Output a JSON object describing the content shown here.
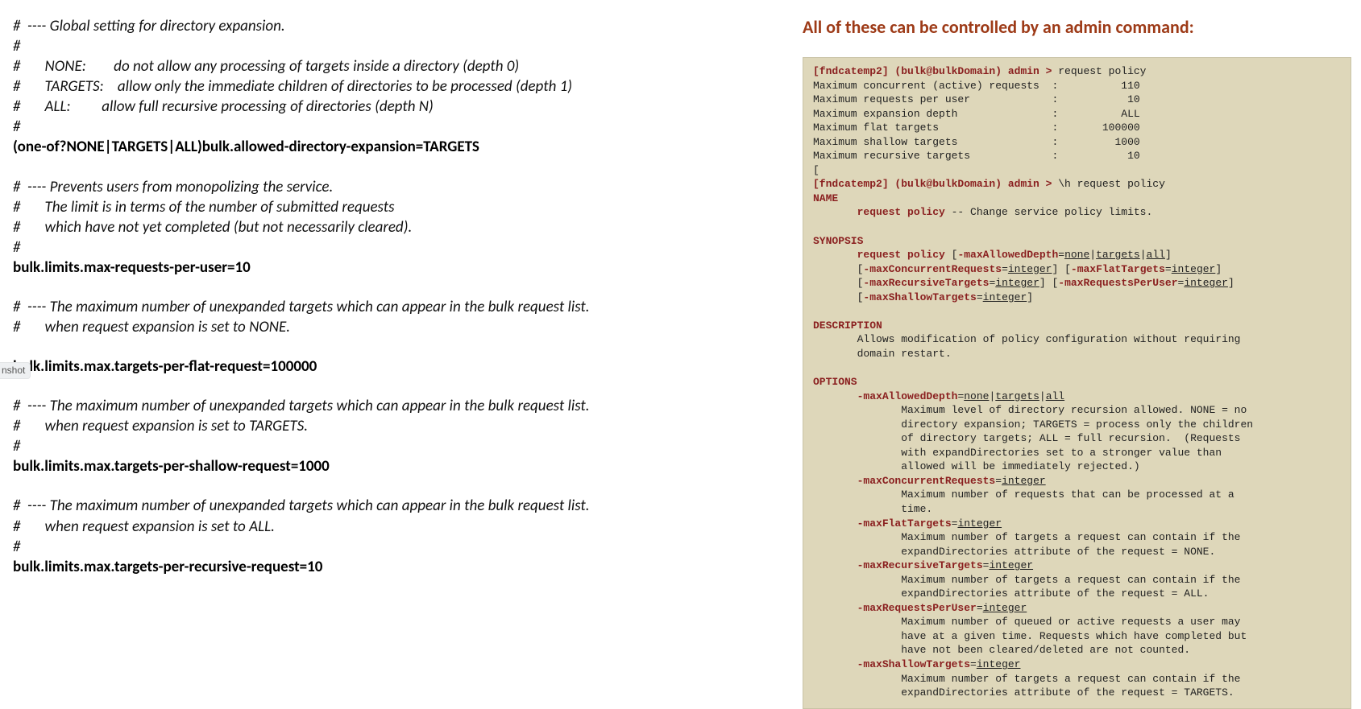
{
  "left": {
    "block1": {
      "c1": "#  ---- Global setting for directory expansion.",
      "c2": "#",
      "c3": "#       NONE:        do not allow any processing of targets inside a directory (depth 0)",
      "c4": "#       TARGETS:    allow only the immediate children of directories to be processed (depth 1)",
      "c5": "#       ALL:         allow full recursive processing of directories (depth N)",
      "c6": "#",
      "s": "(one-of?NONE|TARGETS|ALL)bulk.allowed-directory-expansion=TARGETS"
    },
    "block2": {
      "c1": "#  ---- Prevents users from monopolizing the service.",
      "c2": "#       The limit is in terms of the number of submitted requests",
      "c3": "#       which have not yet completed (but not necessarily cleared).",
      "c4": "#",
      "s": "bulk.limits.max-requests-per-user=10"
    },
    "block3": {
      "c1": "#  ---- The maximum number of unexpanded targets which can appear in the bulk request list.",
      "c2": "#       when request expansion is set to NONE.",
      "s": "bulk.limits.max.targets-per-flat-request=100000"
    },
    "block4": {
      "c1": "#  ---- The maximum number of unexpanded targets which can appear in the bulk request list.",
      "c2": "#       when request expansion is set to TARGETS.",
      "c3": "#",
      "s": "bulk.limits.max.targets-per-shallow-request=1000"
    },
    "block5": {
      "c1": "#  ---- The maximum number of unexpanded targets which can appear in the bulk request list.",
      "c2": "#       when request expansion is set to ALL.",
      "c3": "#",
      "s": "bulk.limits.max.targets-per-recursive-request=10"
    }
  },
  "right": {
    "heading": "All of these can be controlled by an admin command:",
    "term": {
      "p1_prompt": "[fndcatemp2] (bulk@bulkDomain) admin > ",
      "p1_cmd": "request policy",
      "rows": {
        "r1": {
          "label": "Maximum concurrent (active) requests",
          "value": "110"
        },
        "r2": {
          "label": "Maximum requests per user",
          "value": "10"
        },
        "r3": {
          "label": "Maximum expansion depth",
          "value": "ALL"
        },
        "r4": {
          "label": "Maximum flat targets",
          "value": "100000"
        },
        "r5": {
          "label": "Maximum shallow targets",
          "value": "1000"
        },
        "r6": {
          "label": "Maximum recursive targets",
          "value": "10"
        }
      },
      "bracket": "[",
      "p2_prompt": "[fndcatemp2] (bulk@bulkDomain) admin > ",
      "p2_cmd": "\\h request policy",
      "name_hdr": "NAME",
      "name_line_b": "request policy",
      "name_line_r": " -- Change service policy limits.",
      "syn_hdr": "SYNOPSIS",
      "syn_cmd": "request policy",
      "syn_o1a": "-maxAllowedDepth",
      "syn_o1v": "none",
      "syn_o1v2": "targets",
      "syn_o1v3": "all",
      "syn_o2a": "-maxConcurrentRequests",
      "syn_int": "integer",
      "syn_o3a": "-maxFlatTargets",
      "syn_o4a": "-maxRecursiveTargets",
      "syn_o5a": "-maxRequestsPerUser",
      "syn_o6a": "-maxShallowTargets",
      "desc_hdr": "DESCRIPTION",
      "desc_l1": "Allows modification of policy configuration without requiring",
      "desc_l2": "domain restart.",
      "opt_hdr": "OPTIONS",
      "opt1_name": "-maxAllowedDepth",
      "opt1_d1": "Maximum level of directory recursion allowed. NONE = no",
      "opt1_d2": "directory expansion; TARGETS = process only the children",
      "opt1_d3": "of directory targets; ALL = full recursion.  (Requests",
      "opt1_d4": "with expandDirectories set to a stronger value than",
      "opt1_d5": "allowed will be immediately rejected.)",
      "opt2_name": "-maxConcurrentRequests",
      "opt2_d1": "Maximum number of requests that can be processed at a",
      "opt2_d2": "time.",
      "opt3_name": "-maxFlatTargets",
      "opt3_d1": "Maximum number of targets a request can contain if the",
      "opt3_d2": "expandDirectories attribute of the request = NONE.",
      "opt4_name": "-maxRecursiveTargets",
      "opt4_d1": "Maximum number of targets a request can contain if the",
      "opt4_d2": "expandDirectories attribute of the request = ALL.",
      "opt5_name": "-maxRequestsPerUser",
      "opt5_d1": "Maximum number of queued or active requests a user may",
      "opt5_d2": "have at a given time. Requests which have completed but",
      "opt5_d3": "have not been cleared/deleted are not counted.",
      "opt6_name": "-maxShallowTargets",
      "opt6_d1": "Maximum number of targets a request can contain if the",
      "opt6_d2": "expandDirectories attribute of the request = TARGETS."
    }
  },
  "tag": "nshot"
}
